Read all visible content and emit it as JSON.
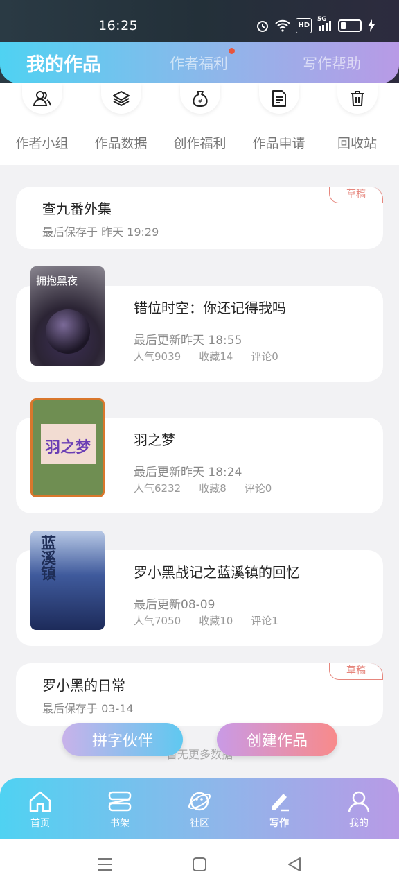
{
  "status": {
    "time": "16:25",
    "network": "5G",
    "hd": "HD"
  },
  "tabs": [
    {
      "label": "我的作品",
      "active": true
    },
    {
      "label": "作者福利",
      "dot": true
    },
    {
      "label": "写作帮助"
    }
  ],
  "tools": [
    {
      "label": "作者小组",
      "icon": "group-icon"
    },
    {
      "label": "作品数据",
      "icon": "layers-icon"
    },
    {
      "label": "创作福利",
      "icon": "money-bag-icon"
    },
    {
      "label": "作品申请",
      "icon": "document-icon"
    },
    {
      "label": "回收站",
      "icon": "trash-icon"
    }
  ],
  "works": [
    {
      "kind": "draft",
      "badge": "草稿",
      "title": "查九番外集",
      "saved": "最后保存于 昨天 19:29"
    },
    {
      "kind": "book",
      "title": "错位时空：你还记得我吗",
      "updated": "最后更新昨天 18:55",
      "popularity": "人气9039",
      "favorites": "收藏14",
      "comments": "评论0",
      "cover_text": "拥抱黑夜"
    },
    {
      "kind": "book",
      "title": "羽之梦",
      "updated": "最后更新昨天 18:24",
      "popularity": "人气6232",
      "favorites": "收藏8",
      "comments": "评论0",
      "cover_text": "羽之梦"
    },
    {
      "kind": "book",
      "title": "罗小黑战记之蓝溪镇的回忆",
      "updated": "最后更新08-09",
      "popularity": "人气7050",
      "favorites": "收藏10",
      "comments": "评论1",
      "cover_text": "蓝溪镇"
    },
    {
      "kind": "draft",
      "badge": "草稿",
      "title": "罗小黑的日常",
      "saved": "最后保存于 03-14"
    }
  ],
  "no_more": "暂无更多数据",
  "float_buttons": {
    "partner": "拼字伙伴",
    "create": "创建作品"
  },
  "bottom_nav": [
    {
      "label": "首页",
      "icon": "home-icon"
    },
    {
      "label": "书架",
      "icon": "bookshelf-icon"
    },
    {
      "label": "社区",
      "icon": "planet-icon"
    },
    {
      "label": "写作",
      "icon": "pen-icon",
      "active": true
    },
    {
      "label": "我的",
      "icon": "profile-icon"
    }
  ],
  "colors": {
    "accent_start": "#4fd2f2",
    "accent_end": "#b89ae6",
    "draft": "#e6867d",
    "create_start": "#c99ae6",
    "create_end": "#f88a8a"
  }
}
